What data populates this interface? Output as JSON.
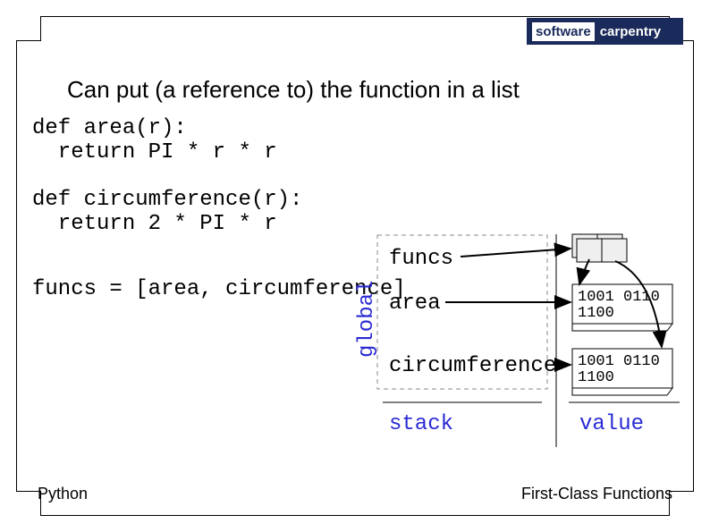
{
  "logo": {
    "left": "software",
    "right": "carpentry"
  },
  "title": "Can put (a reference to) the function in a list",
  "code": {
    "block1": "def area(r):\n  return PI * r * r",
    "block2": "def circumference(r):\n  return 2 * PI * r",
    "block3": "funcs = [area, circumference]"
  },
  "stack": {
    "scope_label": "global",
    "vars": [
      "funcs",
      "area",
      "circumference"
    ],
    "label": "stack"
  },
  "heap": {
    "obj1": "1001 0110\n1100",
    "obj2": "1001 0110\n1100",
    "label": "value"
  },
  "footer": {
    "left": "Python",
    "right": "First-Class Functions"
  }
}
